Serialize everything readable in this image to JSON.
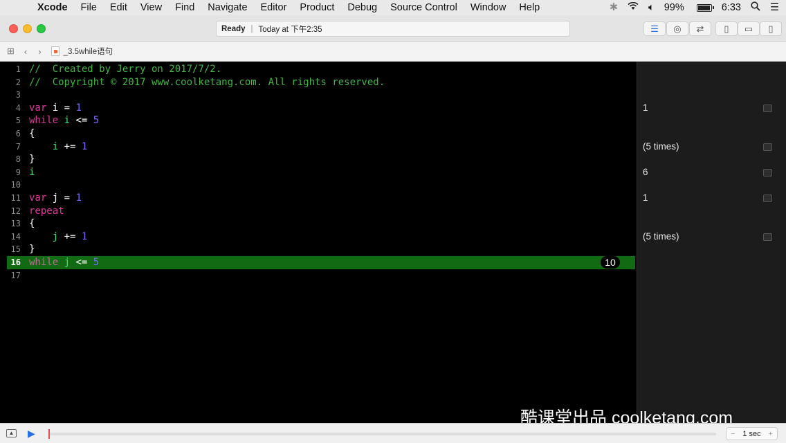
{
  "menubar": {
    "app": "Xcode",
    "items": [
      "File",
      "Edit",
      "View",
      "Find",
      "Navigate",
      "Editor",
      "Product",
      "Debug",
      "Source Control",
      "Window",
      "Help"
    ],
    "battery": "99%",
    "time": "6:33"
  },
  "titlebar": {
    "status": "Ready",
    "timestamp": "Today at 下午2:35"
  },
  "jumpbar": {
    "file_name": "_3.5while语句"
  },
  "editor": {
    "lines": [
      {
        "n": "1",
        "tokens": [
          {
            "t": "//  Created by Jerry on 2017/7/2.",
            "c": "cm"
          }
        ]
      },
      {
        "n": "2",
        "tokens": [
          {
            "t": "//  Copyright © 2017 www.coolketang.com. All rights reserved.",
            "c": "cm"
          }
        ]
      },
      {
        "n": "3",
        "tokens": []
      },
      {
        "n": "4",
        "tokens": [
          {
            "t": "var",
            "c": "kw"
          },
          {
            "t": " i = ",
            "c": ""
          },
          {
            "t": "1",
            "c": "num"
          }
        ]
      },
      {
        "n": "5",
        "tokens": [
          {
            "t": "while",
            "c": "kw"
          },
          {
            "t": " ",
            "c": ""
          },
          {
            "t": "i",
            "c": "idv"
          },
          {
            "t": " <= ",
            "c": ""
          },
          {
            "t": "5",
            "c": "num"
          }
        ]
      },
      {
        "n": "6",
        "tokens": [
          {
            "t": "{",
            "c": ""
          }
        ]
      },
      {
        "n": "7",
        "tokens": [
          {
            "t": "    ",
            "c": ""
          },
          {
            "t": "i",
            "c": "idv"
          },
          {
            "t": " += ",
            "c": ""
          },
          {
            "t": "1",
            "c": "num"
          }
        ]
      },
      {
        "n": "8",
        "tokens": [
          {
            "t": "}",
            "c": ""
          }
        ]
      },
      {
        "n": "9",
        "tokens": [
          {
            "t": "i",
            "c": "idv"
          }
        ]
      },
      {
        "n": "10",
        "tokens": []
      },
      {
        "n": "11",
        "tokens": [
          {
            "t": "var",
            "c": "kw"
          },
          {
            "t": " j = ",
            "c": ""
          },
          {
            "t": "1",
            "c": "num"
          }
        ]
      },
      {
        "n": "12",
        "tokens": [
          {
            "t": "repeat",
            "c": "kw"
          }
        ]
      },
      {
        "n": "13",
        "tokens": [
          {
            "t": "{",
            "c": ""
          }
        ]
      },
      {
        "n": "14",
        "tokens": [
          {
            "t": "    ",
            "c": ""
          },
          {
            "t": "j",
            "c": "idv"
          },
          {
            "t": " += ",
            "c": ""
          },
          {
            "t": "1",
            "c": "num"
          }
        ]
      },
      {
        "n": "15",
        "tokens": [
          {
            "t": "}",
            "c": ""
          }
        ]
      },
      {
        "n": "16",
        "tokens": [
          {
            "t": "while",
            "c": "kw"
          },
          {
            "t": " ",
            "c": ""
          },
          {
            "t": "j",
            "c": "idv"
          },
          {
            "t": " <= ",
            "c": ""
          },
          {
            "t": "5",
            "c": "num"
          }
        ],
        "highlighted": true,
        "bubble": "10"
      },
      {
        "n": "17",
        "tokens": []
      }
    ]
  },
  "results": [
    {
      "line": "4",
      "value": "1"
    },
    {
      "line": "7",
      "value": "(5 times)"
    },
    {
      "line": "9",
      "value": "6"
    },
    {
      "line": "11",
      "value": "1"
    },
    {
      "line": "14",
      "value": "(5 times)"
    }
  ],
  "watermark": "酷课堂出品 coolketang.com",
  "bottombar": {
    "duration": "1 sec",
    "minus": "−",
    "plus": "+"
  },
  "colors": {
    "comment": "#41b645",
    "keyword": "#e1359c",
    "number": "#7b6bff",
    "identifier": "#3fe07a",
    "highlight_line": "#126b12"
  }
}
